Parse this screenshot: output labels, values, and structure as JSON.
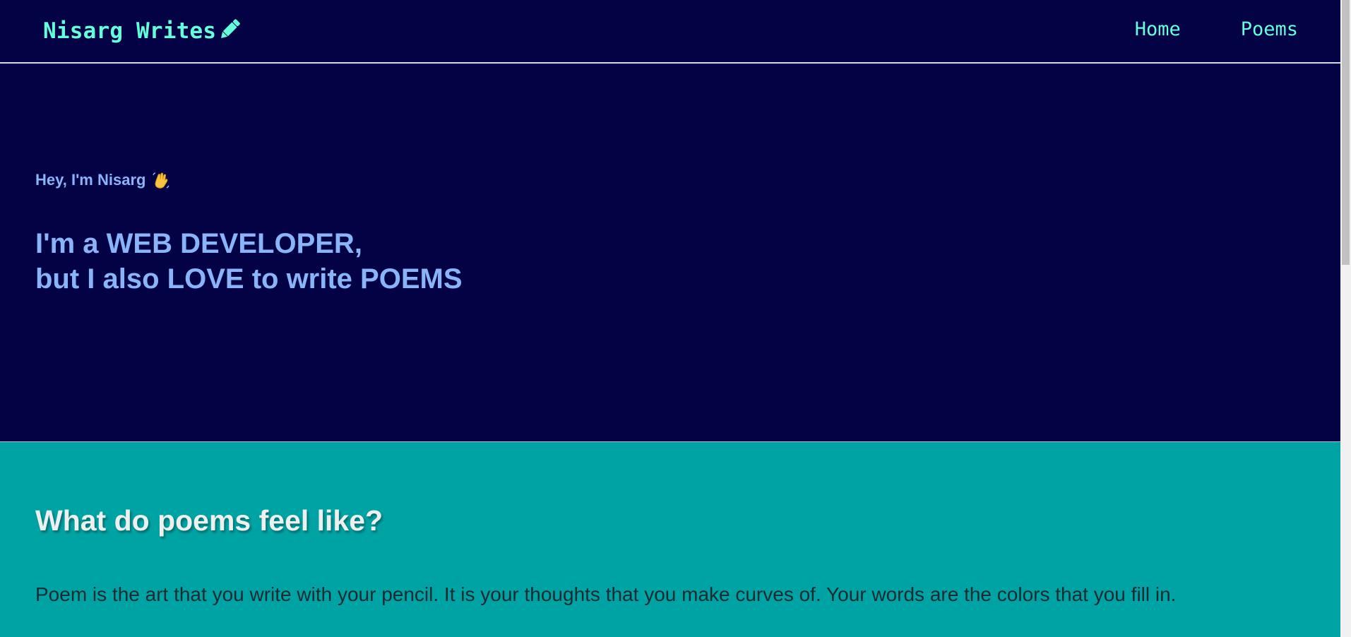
{
  "navbar": {
    "brand": "Nisarg Writes",
    "brand_icon": "pencil-icon",
    "links": [
      {
        "label": "Home"
      },
      {
        "label": "Poems"
      }
    ]
  },
  "hero": {
    "greeting": "Hey, I'm Nisarg",
    "greeting_icon": "waving-hand-icon",
    "headline_line1": "I'm a WEB DEVELOPER,",
    "headline_line2": "but I also LOVE to write POEMS"
  },
  "about": {
    "title": "What do poems feel like?",
    "text": "Poem is the art that you write with your pencil. It is your thoughts that you make curves of. Your words are the colors that you fill in."
  },
  "colors": {
    "navy": "#030245",
    "accent": "#64ffda",
    "hero_text": "#8ab4f8",
    "teal": "#00a3a3"
  }
}
